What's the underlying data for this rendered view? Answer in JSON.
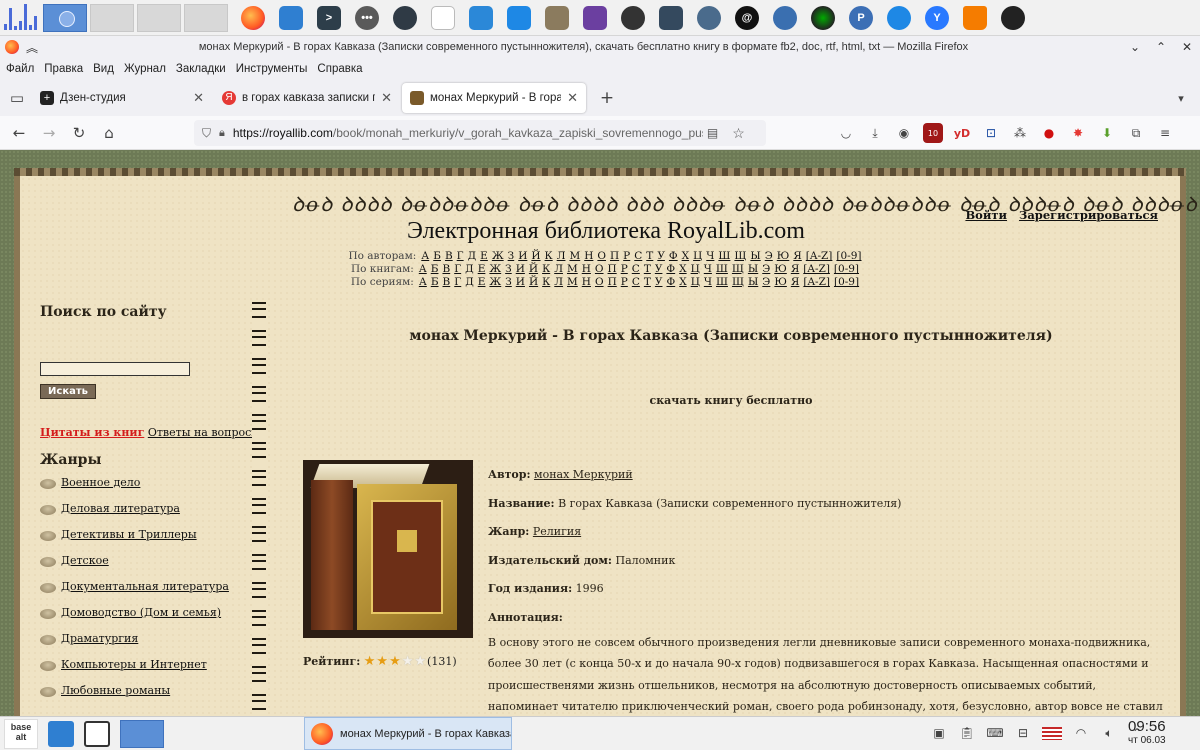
{
  "window": {
    "title": "монах Меркурий - В горах Кавказа (Записки современного пустынножителя), скачать бесплатно книгу в формате fb2, doc, rtf, html, txt — Mozilla Firefox"
  },
  "menu": [
    "Файл",
    "Правка",
    "Вид",
    "Журнал",
    "Закладки",
    "Инструменты",
    "Справка"
  ],
  "tabs": [
    {
      "label": "Дзен-студия",
      "favicon_color": "#222222",
      "favicon": "plus-icon"
    },
    {
      "label": "в горах кавказа записки пуст",
      "favicon_color": "#e53935",
      "favicon": "yandex-icon"
    },
    {
      "label": "монах Меркурий - В горах Кав",
      "favicon_color": "#7a5a2a",
      "favicon": "book-icon"
    }
  ],
  "url": {
    "host": "https://royallib.com",
    "path": "/book/monah_merkuriy/v_gorah_kavkaza_zapiski_sovremennogo_pustinnogi"
  },
  "toolbar_icons": [
    "pocket-icon",
    "download-icon",
    "account-icon",
    "ublock-icon",
    "yd-icon",
    "translate-icon",
    "dots-icon",
    "red-drop-icon",
    "colorful-icon",
    "green-arrow-icon",
    "extensions-icon",
    "menu-icon"
  ],
  "extension_badge": "10",
  "yd_label": "yD",
  "site": {
    "elvish": "ꝺꝋꝺ ꝺꝺꝺꝺ ꝺꝋꝺꝺꝋꝺꝺꝋ ꝺꝋꝺ ꝺꝺꝺꝺ ꝺꝺꝺ ꝺꝺꝺꝋ   ꝺꝋꝺ ꝺꝺꝺꝺ ꝺꝋꝺꝺꝋꝺꝺꝋ ꝺꝋꝺ ꝺꝺꝺꝋꝺ ꝺꝋꝺ ꝺꝺꝺꝋꝺ",
    "title": "Электронная библиотека RoyalLib.com",
    "login": "Войти",
    "register": "Зарегистрироваться",
    "by_authors": "По авторам:",
    "by_books": "По книгам:",
    "by_series": "По сериям:",
    "letters": [
      "А",
      "Б",
      "В",
      "Г",
      "Д",
      "Е",
      "Ж",
      "З",
      "И",
      "Й",
      "К",
      "Л",
      "М",
      "Н",
      "О",
      "П",
      "Р",
      "С",
      "Т",
      "У",
      "Ф",
      "Х",
      "Ц",
      "Ч",
      "Ш",
      "Щ",
      "Ы",
      "Э",
      "Ю",
      "Я",
      "[A-Z]",
      "[0-9]"
    ]
  },
  "sidebar": {
    "search_title": "Поиск по сайту",
    "search_value": "",
    "search_button": "Искать",
    "quotes_link": "Цитаты из книг",
    "answers_link": "Ответы на вопросы",
    "genres_title": "Жанры",
    "genres": [
      "Военное дело",
      "Деловая литература",
      "Детективы и Триллеры",
      "Детское",
      "Документальная литература",
      "Домоводство (Дом и семья)",
      "Драматургия",
      "Компьютеры и Интернет",
      "Любовные романы"
    ]
  },
  "book": {
    "heading": "монах Меркурий - В горах Кавказа (Записки современного пустынножителя)",
    "download": "скачать книгу бесплатно",
    "author_label": "Автор:",
    "author": "монах Меркурий",
    "title_label": "Название:",
    "title": "В горах Кавказа (Записки современного пустынножителя)",
    "genre_label": "Жанр:",
    "genre": "Религия",
    "publisher_label": "Издательский дом:",
    "publisher": "Паломник",
    "year_label": "Год издания:",
    "year": "1996",
    "annotation_label": "Аннотация:",
    "annotation": "В основу этого не совсем обычного произведения легли дневниковые записи современного монаха-подвижника, более 30 лет (с конца 50-х и до начала 90-х годов) подвизавшегося в горах Кавказа. Насыщенная опасностями и происшественями жизнь отшельников, несмотря на абсолютную достоверность описываемых событий, напоминает читателю приключенческий роман, своего рода робинзонаду, хотя, безусловно, автор вовсе не ставил перед собой",
    "rating_label": "Рейтинг:",
    "rating_value": 3,
    "rating_max": 5,
    "rating_count": "(131)"
  },
  "taskbar": {
    "start_label": "base alt",
    "task_title": "монах Меркурий - В горах Кавказа (Записки современного пустынно...",
    "time": "09:56",
    "date": "чт 06.03"
  }
}
